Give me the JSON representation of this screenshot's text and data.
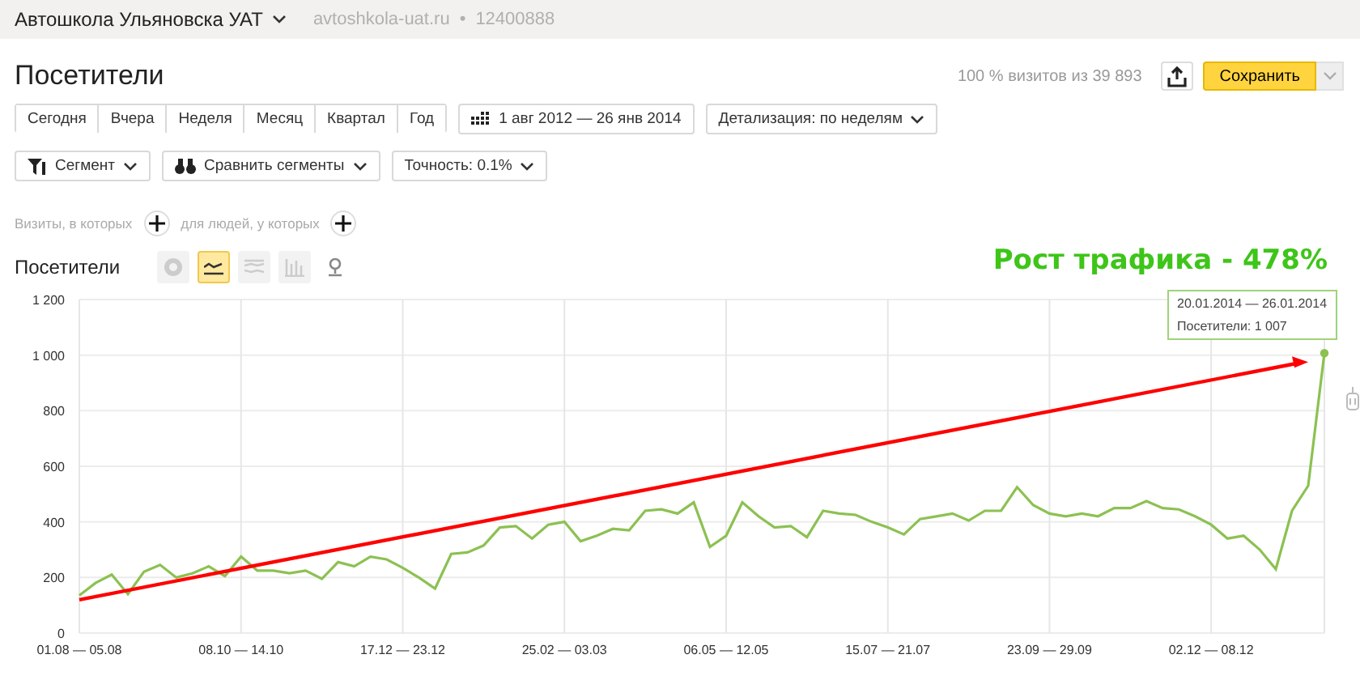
{
  "header": {
    "counter_name": "Автошкола Ульяновска УАТ",
    "site": "avtoshkola-uat.ru",
    "separator": "•",
    "counter_id": "12400888"
  },
  "title": "Посетители",
  "sample_info": "100 % визитов из 39 893",
  "save_button": "Сохранить",
  "periods": [
    {
      "label": "Сегодня",
      "selected": false
    },
    {
      "label": "Вчера",
      "selected": false
    },
    {
      "label": "Неделя",
      "selected": false
    },
    {
      "label": "Месяц",
      "selected": false
    },
    {
      "label": "Квартал",
      "selected": false
    },
    {
      "label": "Год",
      "selected": false
    }
  ],
  "date_range": "1 авг 2012 — 26 янв 2014",
  "detail": "Детализация: по неделям",
  "filters": [
    {
      "kind": "segment",
      "label": "Сегмент"
    },
    {
      "kind": "compare",
      "label": "Сравнить сегменты"
    },
    {
      "kind": "plain",
      "label": "Точность: 0.1%"
    }
  ],
  "conditions": {
    "visits": "Визиты, в которых",
    "people": "для людей, у которых"
  },
  "chart_header": {
    "label": "Посетители",
    "views": [
      {
        "kind": "pie",
        "selected": false
      },
      {
        "kind": "line",
        "selected": true
      },
      {
        "kind": "stack",
        "selected": false
      },
      {
        "kind": "bars",
        "selected": false
      },
      {
        "kind": "map",
        "selected": false
      }
    ]
  },
  "headline": "Рост трафика - 478%",
  "tooltip": {
    "range": "20.01.2014 — 26.01.2014",
    "text": "Посетители: 1 007"
  },
  "trend_arrow": {
    "color": "#ff0000"
  },
  "chart_data": {
    "type": "line",
    "grid": true,
    "categories": [
      "01.08 — 05.08",
      null,
      null,
      null,
      null,
      null,
      null,
      null,
      null,
      null,
      "08.10 — 14.10",
      null,
      null,
      null,
      null,
      null,
      null,
      null,
      null,
      null,
      "17.12 — 23.12",
      null,
      null,
      null,
      null,
      null,
      null,
      null,
      null,
      null,
      "25.02 — 03.03",
      null,
      null,
      null,
      null,
      null,
      null,
      null,
      null,
      null,
      "06.05 — 12.05",
      null,
      null,
      null,
      null,
      null,
      null,
      null,
      null,
      null,
      "15.07 — 21.07",
      null,
      null,
      null,
      null,
      null,
      null,
      null,
      null,
      null,
      "23.09 — 29.09",
      null,
      null,
      null,
      null,
      null,
      null,
      null,
      null,
      null,
      "02.12 — 08.12",
      null,
      null,
      null,
      null,
      null,
      null,
      null
    ],
    "ylim": [
      0,
      1200
    ],
    "yticks": [
      {
        "value": 0,
        "label": "0"
      },
      {
        "value": 200,
        "label": "200"
      },
      {
        "value": 400,
        "label": "400"
      },
      {
        "value": 600,
        "label": "600"
      },
      {
        "value": 800,
        "label": "800"
      },
      {
        "value": 1000,
        "label": "1 000"
      },
      {
        "value": 1200,
        "label": "1 200"
      }
    ],
    "series": [
      {
        "color": "#8cc152",
        "values": [
          135,
          180,
          210,
          140,
          220,
          245,
          200,
          215,
          240,
          205,
          275,
          225,
          225,
          215,
          225,
          195,
          255,
          240,
          275,
          265,
          235,
          200,
          160,
          285,
          290,
          315,
          380,
          385,
          340,
          390,
          400,
          330,
          350,
          375,
          370,
          440,
          445,
          430,
          470,
          310,
          350,
          470,
          420,
          380,
          385,
          345,
          440,
          430,
          425,
          400,
          380,
          355,
          410,
          420,
          430,
          405,
          440,
          440,
          525,
          460,
          430,
          420,
          430,
          420,
          450,
          450,
          475,
          450,
          445,
          420,
          390,
          340,
          350,
          300,
          230,
          440,
          530,
          1007
        ]
      }
    ]
  }
}
